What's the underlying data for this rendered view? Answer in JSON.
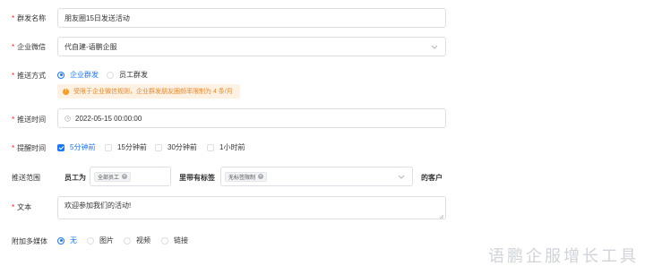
{
  "form": {
    "group_name": {
      "label": "群发名称",
      "value": "朋友圈15日发送活动"
    },
    "enterprise_wechat": {
      "label": "企业微信",
      "value": "代自建-语鹏企服"
    },
    "push_method": {
      "label": "推送方式",
      "options": [
        "企业群发",
        "员工群发"
      ],
      "selected": "企业群发",
      "notice": "受限于企业微信规则，企业群发朋友圈频率限制为 4 条/月"
    },
    "push_time": {
      "label": "推送时间",
      "value": "2022-05-15 00:00:00"
    },
    "remind_time": {
      "label": "提醒时间",
      "options": [
        "5分钟前",
        "15分钟前",
        "30分钟前",
        "1小时前"
      ],
      "checked": [
        "5分钟前"
      ]
    },
    "push_scope": {
      "label": "推送范围",
      "employee_prefix": "员工为",
      "employee_tag": "全部员工",
      "tag_prefix": "里带有标签",
      "tag_value": "无标签限制",
      "suffix": "的客户"
    },
    "text": {
      "label": "文本",
      "value": "欢迎参加我们的活动!"
    },
    "media": {
      "label": "附加多媒体",
      "options": [
        "无",
        "图片",
        "视频",
        "链接"
      ],
      "selected": "无"
    }
  },
  "watermark": "语鹏企服增长工具",
  "colors": {
    "accent": "#1677ff",
    "required": "#f5222d",
    "warning": "#f59a23",
    "warning_bg": "#fdf1e4",
    "border": "#dcdfe6"
  },
  "icons": {
    "select_arrow": "chevron-down-icon",
    "calendar": "clock-icon",
    "tag_remove": "close-circle-icon",
    "warning": "exclamation-icon"
  }
}
